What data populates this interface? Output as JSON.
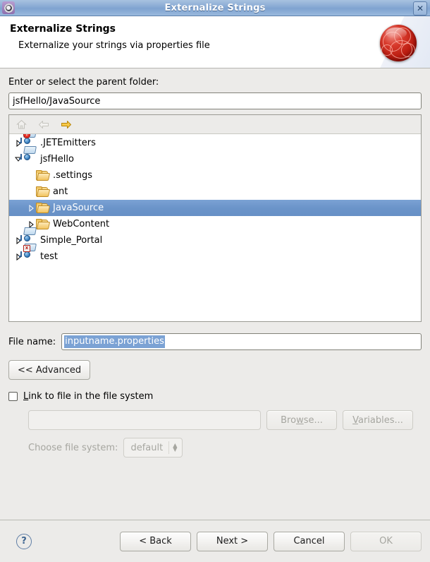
{
  "window": {
    "title": "Externalize Strings",
    "app_icon": "gear-icon",
    "close_label": "✕"
  },
  "banner": {
    "title": "Externalize Strings",
    "subtitle": "Externalize your strings via properties file",
    "graphic": "eclipse-red-sphere-icon"
  },
  "parent_folder": {
    "label": "Enter or select the parent folder:",
    "value": "jsfHello/JavaSource",
    "placeholder": ""
  },
  "tree_toolbar": {
    "home": {
      "name": "home-icon",
      "enabled": false
    },
    "back": {
      "name": "back-arrow-icon",
      "enabled": false
    },
    "forward": {
      "name": "forward-arrow-icon",
      "enabled": true
    }
  },
  "tree": [
    {
      "label": ".JETEmitters",
      "indent": 0,
      "twisty": "collapsed",
      "icon": "project",
      "decoration": "warn",
      "selected": false
    },
    {
      "label": "jsfHello",
      "indent": 0,
      "twisty": "expanded",
      "icon": "project",
      "decoration": "none",
      "selected": false
    },
    {
      "label": ".settings",
      "indent": 1,
      "twisty": "none",
      "icon": "folder",
      "decoration": "none",
      "selected": false
    },
    {
      "label": "ant",
      "indent": 1,
      "twisty": "none",
      "icon": "folder",
      "decoration": "none",
      "selected": false
    },
    {
      "label": "JavaSource",
      "indent": 1,
      "twisty": "collapsed",
      "icon": "folder",
      "decoration": "none",
      "selected": true
    },
    {
      "label": "WebContent",
      "indent": 1,
      "twisty": "collapsed",
      "icon": "folder",
      "decoration": "none",
      "selected": false
    },
    {
      "label": "Simple_Portal",
      "indent": 0,
      "twisty": "collapsed",
      "icon": "project",
      "decoration": "none",
      "selected": false
    },
    {
      "label": "test",
      "indent": 0,
      "twisty": "collapsed",
      "icon": "project",
      "decoration": "error",
      "selected": false
    }
  ],
  "file_name": {
    "label": "File name:",
    "value": "inputname.properties",
    "selected": true
  },
  "advanced": {
    "toggle_label": "<< Advanced",
    "link_checkbox": {
      "label_before": "",
      "mnemonic": "L",
      "label_after": "ink to file in the file system",
      "checked": false
    },
    "link_path_value": "",
    "browse": {
      "before": "Bro",
      "mnemonic": "w",
      "after": "se...",
      "enabled": false
    },
    "variables": {
      "before": "",
      "mnemonic": "V",
      "after": "ariables...",
      "enabled": false
    },
    "file_system_label": "Choose file system:",
    "file_system_value": "default",
    "file_system_options": [
      "default"
    ]
  },
  "footer": {
    "help": "?",
    "back": "< Back",
    "next": "Next >",
    "cancel": "Cancel",
    "ok": "OK",
    "ok_enabled": false
  },
  "colors": {
    "dialog_bg": "#ecebe9",
    "selection_blue": "#6b94c9",
    "title_blue": "#89aad4",
    "accent_red": "#bb1d11",
    "folder_tan": "#f2c45f"
  }
}
